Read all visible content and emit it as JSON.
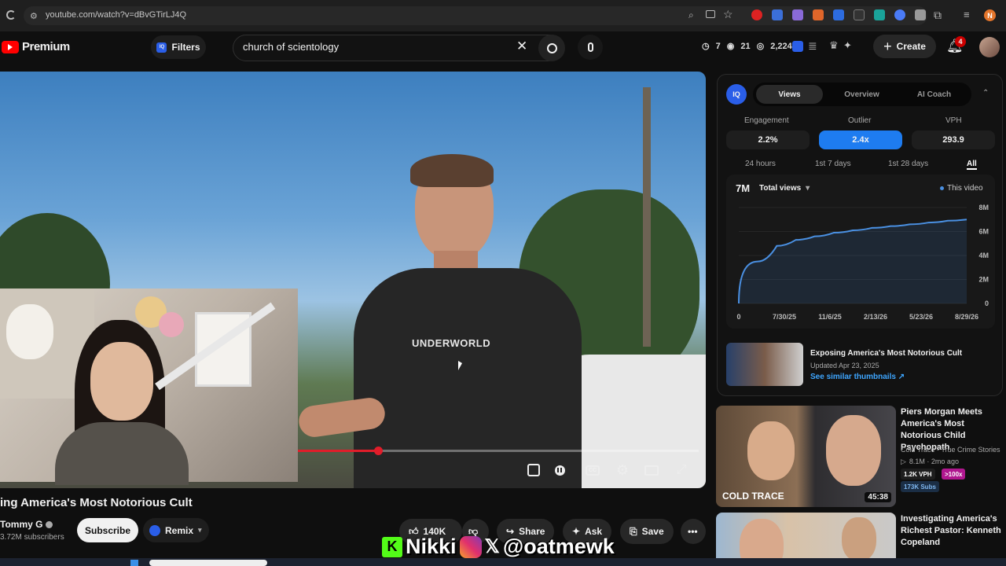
{
  "browser": {
    "url": "youtube.com/watch?v=dBvGTirLJ4Q"
  },
  "header": {
    "logo": "Premium",
    "filters_label": "Filters",
    "search_value": "church of scientology",
    "stats": {
      "clock": "7",
      "eye": "21",
      "views": "2,224"
    },
    "create_label": "Create",
    "notif_count": "4"
  },
  "video": {
    "shirt_text": "UNDERWORLD",
    "progress": 0.2
  },
  "below": {
    "title": "ing America's Most Notorious Cult",
    "channel": "Tommy G",
    "subs": "3.72M subscribers",
    "subscribe_label": "Subscribe",
    "remix_label": "Remix",
    "likes": "140K",
    "share_label": "Share",
    "ask_label": "Ask",
    "save_label": "Save"
  },
  "overlay": {
    "handle_name": "Nikki",
    "handle_tag": "@oatmewk"
  },
  "vidiq": {
    "tabs": [
      "Views",
      "Overview",
      "AI Coach"
    ],
    "stats": [
      {
        "label": "Engagement",
        "value": "2.2%"
      },
      {
        "label": "Outlier",
        "value": "2.4x"
      },
      {
        "label": "VPH",
        "value": "293.9"
      }
    ],
    "ranges": [
      "24 hours",
      "1st 7 days",
      "1st 28 days",
      "All"
    ],
    "total": "7M",
    "total_label": "Total views",
    "legend": "This video",
    "chart_data": {
      "type": "line",
      "x": [
        "0",
        "7/30/25",
        "11/6/25",
        "2/13/26",
        "5/23/26",
        "8/29/26"
      ],
      "y_ticks": [
        "8M",
        "6M",
        "4M",
        "2M",
        "0"
      ],
      "ylim": [
        0,
        8000000
      ],
      "series": [
        {
          "name": "This video",
          "color": "#4a90e2",
          "values": [
            0,
            3500000,
            4800000,
            5300000,
            5600000,
            5900000,
            6100000,
            6300000,
            6450000,
            6600000,
            6750000,
            6900000,
            7000000
          ]
        }
      ]
    },
    "thumb": {
      "title": "Exposing America's Most Notorious Cult",
      "updated": "Updated Apr 23, 2025",
      "link": "See similar thumbnails ↗"
    }
  },
  "recs": [
    {
      "title": "Piers Morgan Meets America's Most Notorious Child Psychopath",
      "channel": "Cold Trace - True Crime Stories",
      "meta": "8.1M · 2mo ago",
      "vph": "1.2K VPH",
      "outlier": ">100x",
      "subs": "173K Subs",
      "duration": "45:38",
      "thumb_text": "COLD TRACE"
    },
    {
      "title": "Investigating America's Richest Pastor: Kenneth Copeland"
    }
  ],
  "colors": {
    "accent": "#3ea6ff",
    "red": "#ff0000",
    "vidiq_blue": "#1a73e8"
  }
}
